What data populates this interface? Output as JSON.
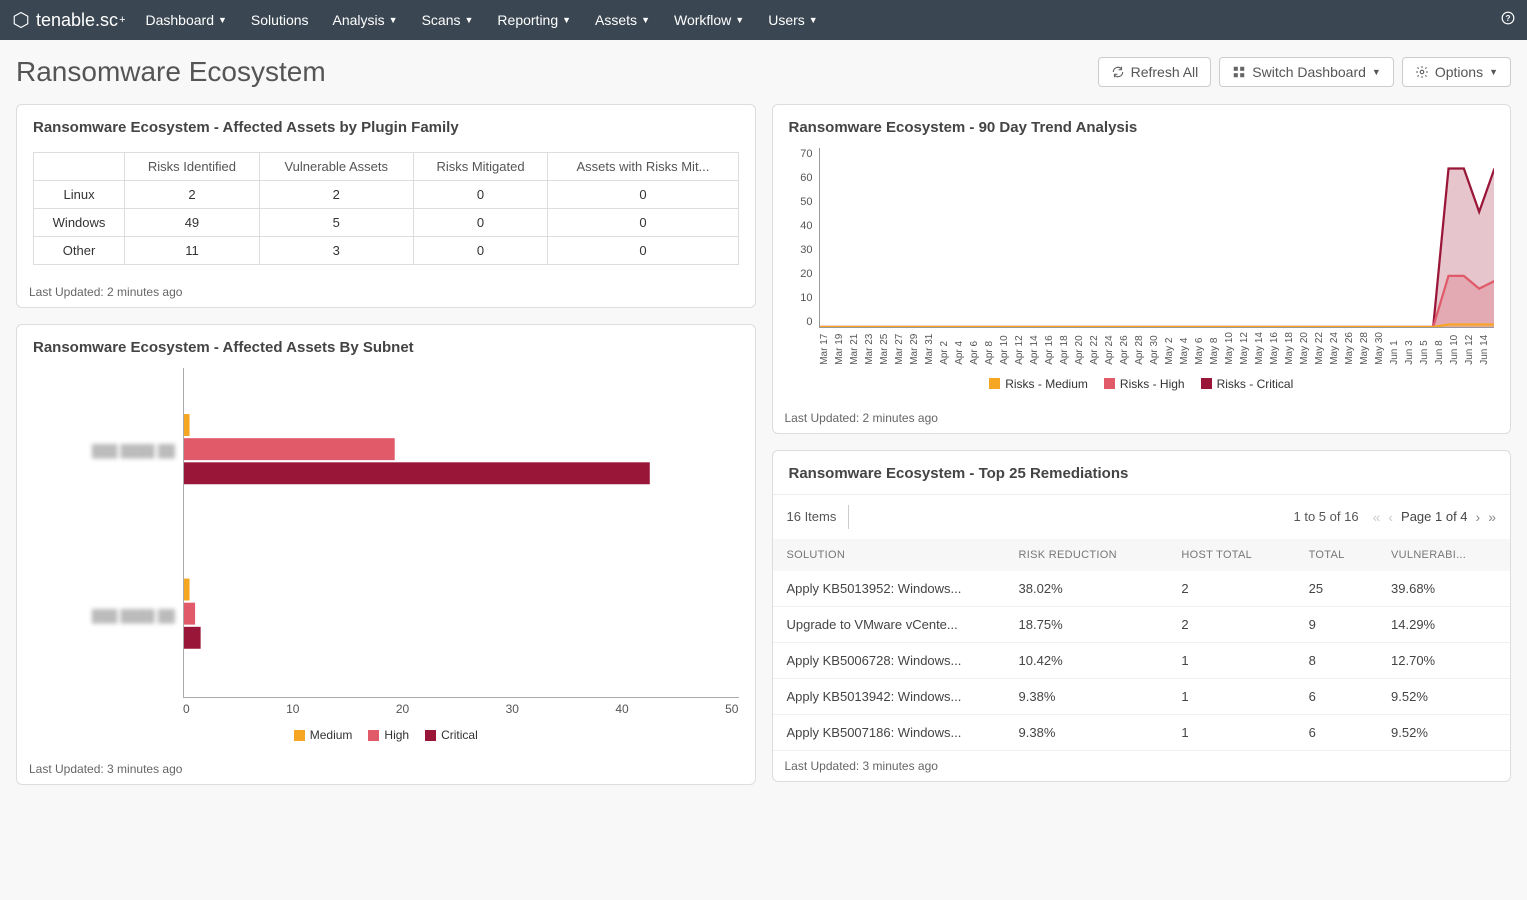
{
  "nav": {
    "brand": "tenable.sc",
    "brand_suffix": "+",
    "items": [
      "Dashboard",
      "Solutions",
      "Analysis",
      "Scans",
      "Reporting",
      "Assets",
      "Workflow",
      "Users"
    ],
    "items_dropdown": [
      true,
      false,
      true,
      true,
      true,
      true,
      true,
      true
    ]
  },
  "page": {
    "title": "Ransomware Ecosystem",
    "refresh": "Refresh All",
    "switch": "Switch Dashboard",
    "options": "Options"
  },
  "card_affected": {
    "title": "Ransomware Ecosystem - Affected Assets by Plugin Family",
    "footer": "Last Updated: 2 minutes ago",
    "cols": [
      "",
      "Risks Identified",
      "Vulnerable Assets",
      "Risks Mitigated",
      "Assets with Risks Mit..."
    ],
    "rows": [
      [
        "Linux",
        "2",
        "2",
        "0",
        "0"
      ],
      [
        "Windows",
        "49",
        "5",
        "0",
        "0"
      ],
      [
        "Other",
        "11",
        "3",
        "0",
        "0"
      ]
    ]
  },
  "card_subnet": {
    "title": "Ransomware Ecosystem - Affected Assets By Subnet",
    "footer": "Last Updated: 3 minutes ago",
    "legend": [
      "Medium",
      "High",
      "Critical"
    ],
    "colors": {
      "medium": "#f5a623",
      "high": "#e05a6a",
      "critical": "#9a1638"
    }
  },
  "card_trend": {
    "title": "Ransomware Ecosystem - 90 Day Trend Analysis",
    "footer": "Last Updated: 2 minutes ago",
    "legend": [
      "Risks - Medium",
      "Risks - High",
      "Risks - Critical"
    ],
    "colors": {
      "medium": "#f5a623",
      "high": "#e05a6a",
      "critical": "#9a1638"
    },
    "y_ticks": [
      "70",
      "60",
      "50",
      "40",
      "30",
      "20",
      "10",
      "0"
    ]
  },
  "card_rem": {
    "title": "Ransomware Ecosystem - Top 25 Remediations",
    "items_label": "16 Items",
    "range": "1 to 5 of 16",
    "page_label": "Page 1 of 4",
    "footer": "Last Updated: 3 minutes ago",
    "cols": [
      "SOLUTION",
      "RISK REDUCTION",
      "HOST TOTAL",
      "TOTAL",
      "VULNERABI..."
    ],
    "rows": [
      [
        "Apply KB5013952: Windows...",
        "38.02%",
        "2",
        "25",
        "39.68%"
      ],
      [
        "Upgrade to VMware vCente...",
        "18.75%",
        "2",
        "9",
        "14.29%"
      ],
      [
        "Apply KB5006728: Windows...",
        "10.42%",
        "1",
        "8",
        "12.70%"
      ],
      [
        "Apply KB5013942: Windows...",
        "9.38%",
        "1",
        "6",
        "9.52%"
      ],
      [
        "Apply KB5007186: Windows...",
        "9.38%",
        "1",
        "6",
        "9.52%"
      ]
    ]
  },
  "chart_data": [
    {
      "type": "bar",
      "orientation": "horizontal",
      "title": "Ransomware Ecosystem - Affected Assets By Subnet",
      "categories": [
        "Subnet A (redacted)",
        "Subnet B (redacted)"
      ],
      "series": [
        {
          "name": "Medium",
          "values": [
            0.5,
            0.5
          ],
          "color": "#f5a623"
        },
        {
          "name": "High",
          "values": [
            19,
            1
          ],
          "color": "#e05a6a"
        },
        {
          "name": "Critical",
          "values": [
            42,
            1.5
          ],
          "color": "#9a1638"
        }
      ],
      "xlim": [
        0,
        50
      ],
      "x_ticks": [
        0,
        10,
        20,
        30,
        40,
        50
      ]
    },
    {
      "type": "area",
      "title": "Ransomware Ecosystem - 90 Day Trend Analysis",
      "x": [
        "Mar 17",
        "Mar 19",
        "Mar 21",
        "Mar 23",
        "Mar 25",
        "Mar 27",
        "Mar 29",
        "Mar 31",
        "Apr 2",
        "Apr 4",
        "Apr 6",
        "Apr 8",
        "Apr 10",
        "Apr 12",
        "Apr 14",
        "Apr 16",
        "Apr 18",
        "Apr 20",
        "Apr 22",
        "Apr 24",
        "Apr 26",
        "Apr 28",
        "Apr 30",
        "May 2",
        "May 4",
        "May 6",
        "May 8",
        "May 10",
        "May 12",
        "May 14",
        "May 16",
        "May 18",
        "May 20",
        "May 22",
        "May 24",
        "May 26",
        "May 28",
        "May 30",
        "Jun 1",
        "Jun 3",
        "Jun 5",
        "Jun 8",
        "Jun 10",
        "Jun 12",
        "Jun 14"
      ],
      "series": [
        {
          "name": "Risks - Medium",
          "color": "#f5a623",
          "values": [
            0,
            0,
            0,
            0,
            0,
            0,
            0,
            0,
            0,
            0,
            0,
            0,
            0,
            0,
            0,
            0,
            0,
            0,
            0,
            0,
            0,
            0,
            0,
            0,
            0,
            0,
            0,
            0,
            0,
            0,
            0,
            0,
            0,
            0,
            0,
            0,
            0,
            0,
            0,
            0,
            0,
            1,
            1,
            1,
            1
          ]
        },
        {
          "name": "Risks - High",
          "color": "#e05a6a",
          "values": [
            0,
            0,
            0,
            0,
            0,
            0,
            0,
            0,
            0,
            0,
            0,
            0,
            0,
            0,
            0,
            0,
            0,
            0,
            0,
            0,
            0,
            0,
            0,
            0,
            0,
            0,
            0,
            0,
            0,
            0,
            0,
            0,
            0,
            0,
            0,
            0,
            0,
            0,
            0,
            0,
            0,
            20,
            20,
            15,
            18
          ]
        },
        {
          "name": "Risks - Critical",
          "color": "#9a1638",
          "values": [
            0,
            0,
            0,
            0,
            0,
            0,
            0,
            0,
            0,
            0,
            0,
            0,
            0,
            0,
            0,
            0,
            0,
            0,
            0,
            0,
            0,
            0,
            0,
            0,
            0,
            0,
            0,
            0,
            0,
            0,
            0,
            0,
            0,
            0,
            0,
            0,
            0,
            0,
            0,
            0,
            0,
            62,
            62,
            45,
            62
          ]
        }
      ],
      "ylim": [
        0,
        70
      ]
    }
  ]
}
